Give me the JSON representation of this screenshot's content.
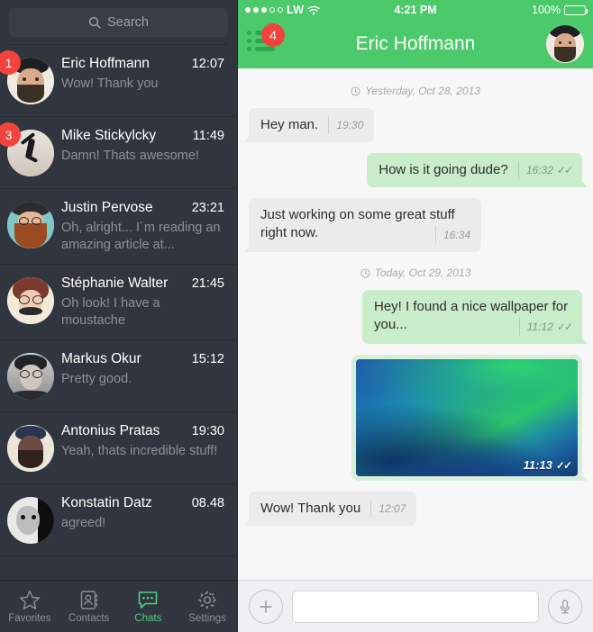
{
  "sidebar": {
    "search": {
      "placeholder": "Search",
      "icon": "search-icon"
    },
    "chats": [
      {
        "name": "Eric Hoffmann",
        "time": "12:07",
        "preview": "Wow! Thank you",
        "badge": "1"
      },
      {
        "name": "Mike Stickylcky",
        "time": "11:49",
        "preview": "Damn! Thats awesome!",
        "badge": "3"
      },
      {
        "name": "Justin Pervose",
        "time": "23:21",
        "preview": "Oh, alright... I´m reading an amazing article at...",
        "badge": ""
      },
      {
        "name": "Stéphanie Walter",
        "time": "21:45",
        "preview": "Oh look! I have a moustache",
        "badge": ""
      },
      {
        "name": "Markus Okur",
        "time": "15:12",
        "preview": "Pretty good.",
        "badge": ""
      },
      {
        "name": "Antonius Pratas",
        "time": "19:30",
        "preview": "Yeah, thats incredible stuff!",
        "badge": ""
      },
      {
        "name": "Konstatin Datz",
        "time": "08.48",
        "preview": "agreed!",
        "badge": ""
      }
    ],
    "tabs": [
      {
        "label": "Favorites",
        "icon": "star-icon",
        "active": false
      },
      {
        "label": "Contacts",
        "icon": "contacts-icon",
        "active": false
      },
      {
        "label": "Chats",
        "icon": "chat-bubble-icon",
        "active": true
      },
      {
        "label": "Settings",
        "icon": "gear-icon",
        "active": false
      }
    ]
  },
  "statusbar": {
    "signal_filled": 3,
    "signal_empty": 2,
    "carrier": "LW",
    "wifi": "wifi-icon",
    "time": "4:21 PM",
    "battery_percent": "100%"
  },
  "navbar": {
    "menu_icon": "list-menu-icon",
    "badge": "4",
    "title": "Eric Hoffmann",
    "avatar": "contact-avatar"
  },
  "conversation": {
    "items": [
      {
        "kind": "date",
        "text": "Yesterday, Oct 28, 2013"
      },
      {
        "kind": "text",
        "dir": "in",
        "text": "Hey man.",
        "time": "19:30",
        "ticks": ""
      },
      {
        "kind": "text",
        "dir": "out",
        "text": "How is it going dude?",
        "time": "16:32",
        "ticks": "✓✓"
      },
      {
        "kind": "text",
        "dir": "in",
        "text": "Just working on some great stuff right now.",
        "time": "16:34",
        "ticks": "",
        "multiline": true
      },
      {
        "kind": "date",
        "text": "Today, Oct 29, 2013"
      },
      {
        "kind": "text",
        "dir": "out",
        "text": "Hey! I found a nice wallpaper for you...",
        "time": "11:12",
        "ticks": "✓✓",
        "multiline": true
      },
      {
        "kind": "image",
        "dir": "out",
        "alt": "wave-wallpaper-photo",
        "time": "11:13",
        "ticks": "✓✓"
      },
      {
        "kind": "text",
        "dir": "in",
        "text": "Wow! Thank you",
        "time": "12:07",
        "ticks": ""
      }
    ]
  },
  "composer": {
    "add_icon": "plus-icon",
    "input_value": "",
    "input_placeholder": "",
    "mic_icon": "microphone-icon"
  },
  "colors": {
    "accent_green": "#4cc96a",
    "badge_red": "#f2443c",
    "sidebar_bg": "#31353f",
    "bubble_in": "#ebebeb",
    "bubble_out": "#c9ecca",
    "tab_active": "#4cd07d"
  }
}
